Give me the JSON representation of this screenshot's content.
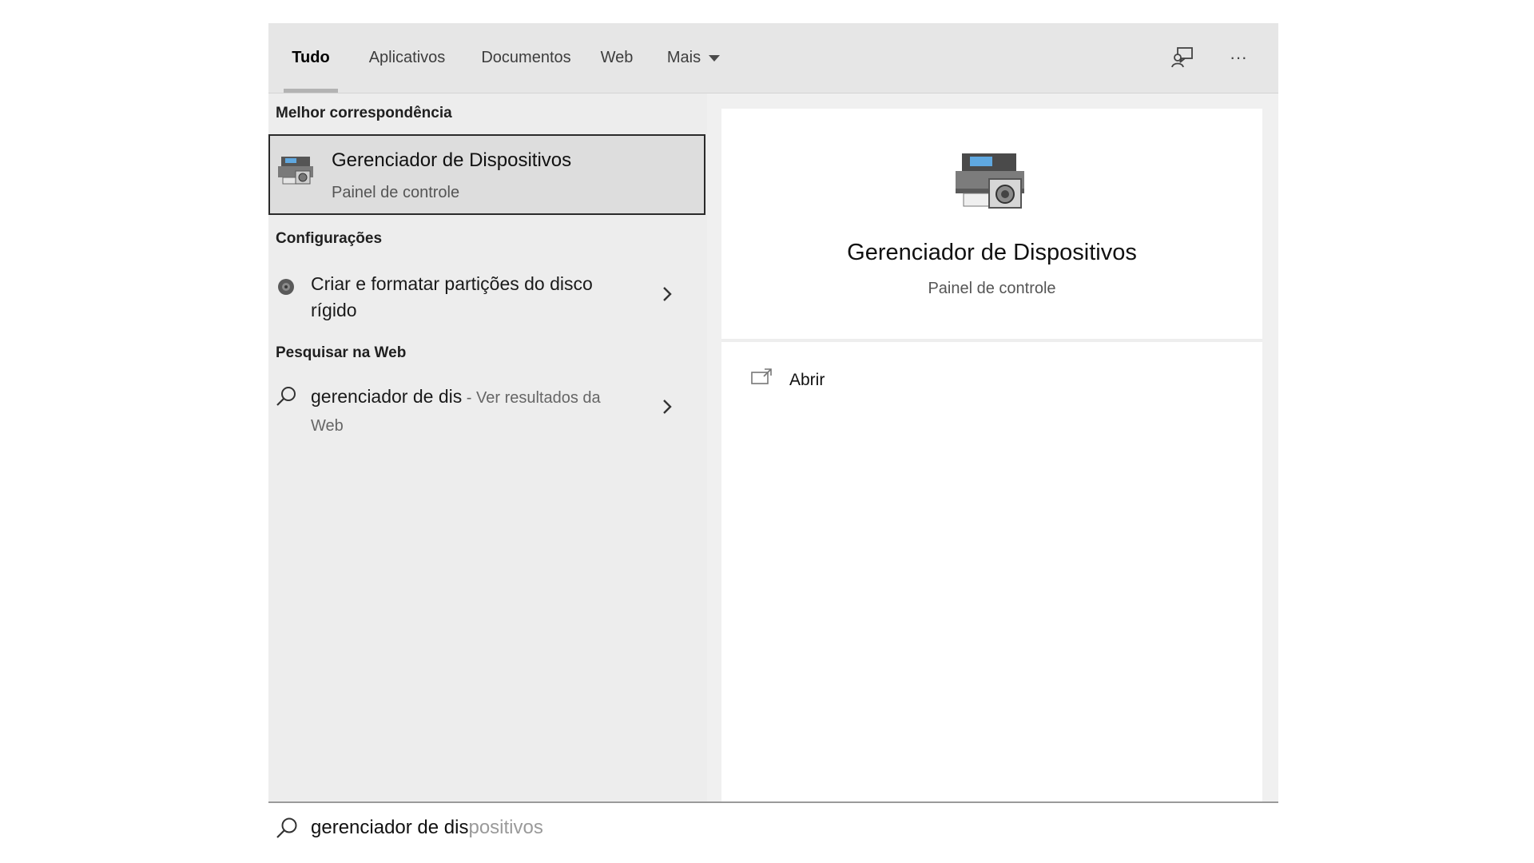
{
  "tabs": [
    {
      "label": "Tudo",
      "active": true
    },
    {
      "label": "Aplicativos",
      "active": false
    },
    {
      "label": "Documentos",
      "active": false
    },
    {
      "label": "Web",
      "active": false
    },
    {
      "label": "Mais",
      "active": false
    }
  ],
  "header_icons": [
    "feedback-icon",
    "more-options-icon"
  ],
  "header_more_glyph": "···",
  "sections": {
    "best_match": "Melhor correspondência",
    "settings": "Configurações",
    "web": "Pesquisar na Web"
  },
  "best_match": {
    "title": "Gerenciador de Dispositivos",
    "subtitle": "Painel de controle",
    "icon": "device-manager-icon"
  },
  "settings_results": [
    {
      "text_line1": "Criar e formatar partições do disco",
      "text_line2": "rígido",
      "icon": "disk-settings-icon"
    }
  ],
  "web_results": [
    {
      "query": "gerenciador de dis",
      "suffix_line1": " - Ver resultados da",
      "suffix_line2": "Web",
      "icon": "search-icon"
    }
  ],
  "preview": {
    "title": "Gerenciador de Dispositivos",
    "subtitle": "Painel de controle",
    "actions": [
      {
        "label": "Abrir",
        "icon": "open-icon"
      }
    ]
  },
  "search": {
    "typed": "gerenciador de dis",
    "suggestion_rest": "positivos"
  },
  "colors": {
    "panel_bg": "#f0f0f0",
    "header_bg": "#e6e6e6",
    "selected_bg": "#dddddd",
    "selected_border": "#2a2a2a"
  }
}
